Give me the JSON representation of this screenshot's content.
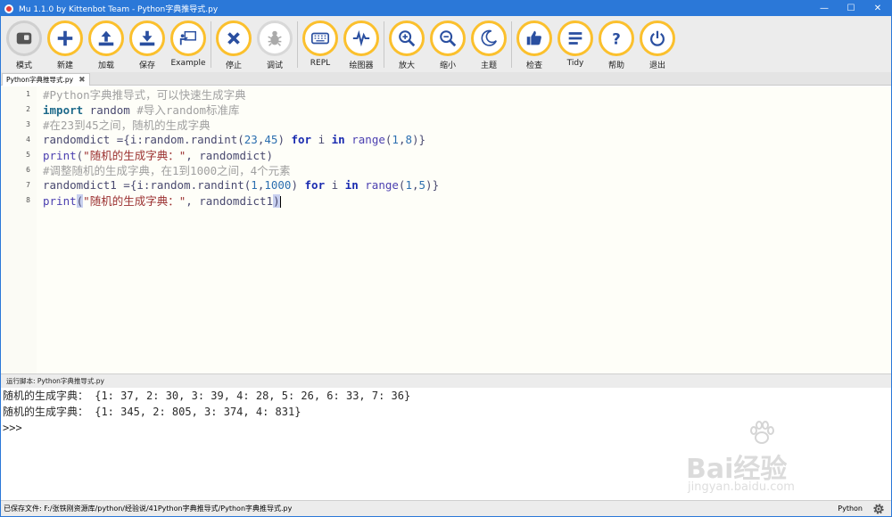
{
  "window": {
    "title": "Mu 1.1.0 by Kittenbot Team - Python字典推导式.py",
    "minimize": "—",
    "maximize": "☐",
    "close": "✕"
  },
  "toolbar": {
    "buttons": [
      {
        "id": "mode",
        "label": "模式",
        "icon": "mode-icon"
      },
      {
        "id": "new",
        "label": "新建",
        "icon": "plus-icon"
      },
      {
        "id": "load",
        "label": "加载",
        "icon": "upload-icon"
      },
      {
        "id": "save",
        "label": "保存",
        "icon": "download-icon"
      },
      {
        "id": "example",
        "label": "Example",
        "icon": "presenter-icon"
      },
      {
        "id": "stop",
        "label": "停止",
        "icon": "stop-icon"
      },
      {
        "id": "debug",
        "label": "调试",
        "icon": "bug-icon"
      },
      {
        "id": "repl",
        "label": "REPL",
        "icon": "keyboard-icon"
      },
      {
        "id": "plotter",
        "label": "绘图器",
        "icon": "pulse-icon"
      },
      {
        "id": "zoom_in",
        "label": "放大",
        "icon": "zoom-in-icon"
      },
      {
        "id": "zoom_out",
        "label": "缩小",
        "icon": "zoom-out-icon"
      },
      {
        "id": "theme",
        "label": "主题",
        "icon": "moon-icon"
      },
      {
        "id": "check",
        "label": "检查",
        "icon": "thumbs-up-icon"
      },
      {
        "id": "tidy",
        "label": "Tidy",
        "icon": "lines-icon"
      },
      {
        "id": "help",
        "label": "帮助",
        "icon": "question-icon"
      },
      {
        "id": "quit",
        "label": "退出",
        "icon": "power-icon"
      }
    ]
  },
  "tab": {
    "label": "Python字典推导式.py",
    "close": "✖"
  },
  "editor": {
    "lines": [
      {
        "num": "1",
        "text": "#Python字典推导式，可以快速生成字典"
      },
      {
        "num": "2",
        "text": "import random #导入random标准库"
      },
      {
        "num": "3",
        "text": "#在23到45之间，随机的生成字典"
      },
      {
        "num": "4",
        "text": "randomdict ={i:random.randint(23,45) for i in range(1,8)}"
      },
      {
        "num": "5",
        "text": "print(\"随机的生成字典：\", randomdict)"
      },
      {
        "num": "6",
        "text": "#调整随机的生成字典，在1到1000之间，4个元素"
      },
      {
        "num": "7",
        "text": "randomdict1 ={i:random.randint(1,1000) for i in range(1,5)}"
      },
      {
        "num": "8",
        "text": "print(\"随机的生成字典：\", randomdict1)"
      }
    ]
  },
  "repl": {
    "header": "运行脚本: Python字典推导式.py",
    "lines": [
      "随机的生成字典： {1: 37, 2: 30, 3: 39, 4: 28, 5: 26, 6: 33, 7: 36}",
      "随机的生成字典： {1: 345, 2: 805, 3: 374, 4: 831}",
      ">>>"
    ]
  },
  "watermark": {
    "text": "Bai经验",
    "sub": "jingyan.baidu.com"
  },
  "status": {
    "saved": "已保存文件: F:/张铁刚资源库/python/经验说/41Python字典推导式/Python字典推导式.py",
    "mode": "Python"
  }
}
